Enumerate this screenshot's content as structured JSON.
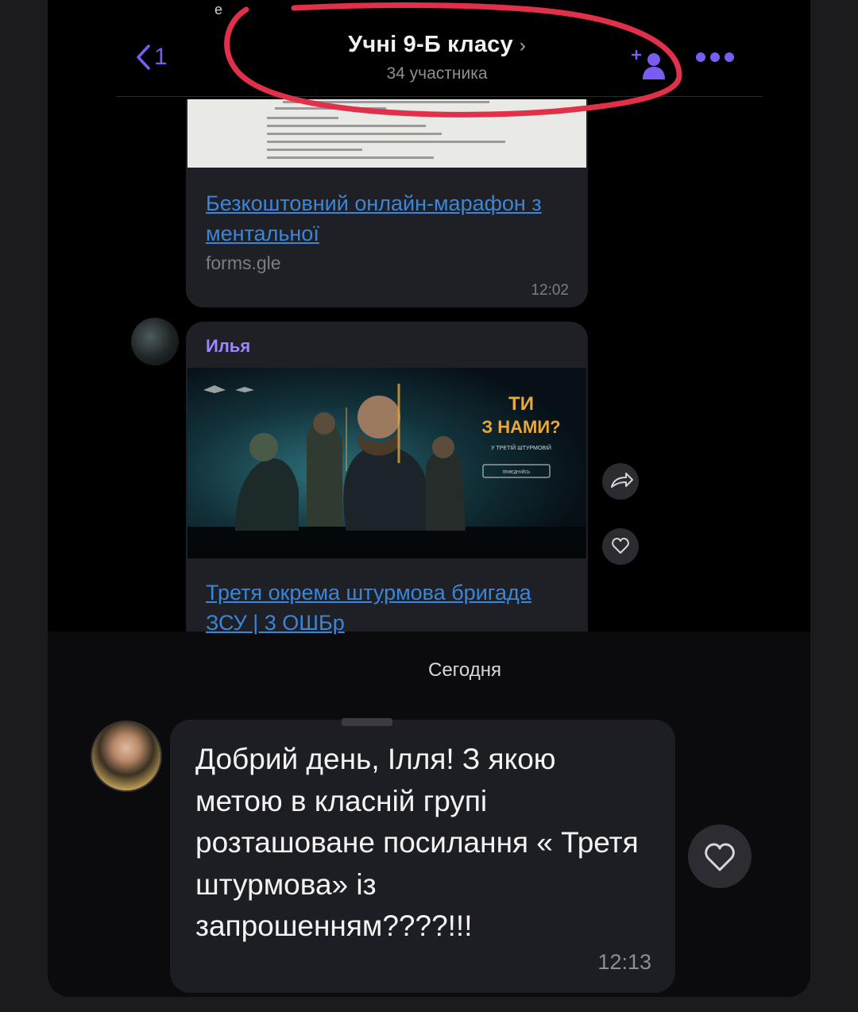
{
  "header": {
    "back_count": "1",
    "title": "Учні 9-Б класу",
    "subtitle": "34 участника",
    "cut_text": "e"
  },
  "colors": {
    "accent": "#7b5cf0",
    "link": "#3a86d8",
    "sender_name": "#9f86ff",
    "bubble": "#1f1f26",
    "annotation_circle": "#e0304a"
  },
  "icons": {
    "back": "chevron-left-icon",
    "title_chevron": "chevron-right-icon",
    "add_member": "add-person-icon",
    "more": "more-dots-icon",
    "share": "share-arrow-icon",
    "like": "heart-icon"
  },
  "messages": [
    {
      "link_title": "Безкоштовний онлайн-марафон з ментальної",
      "domain": "forms.gle",
      "time": "12:02"
    },
    {
      "sender": "Илья",
      "banner": {
        "headline_1": "ТИ",
        "headline_2": "З НАМИ?",
        "tagline": "У ТРЕТІЙ ШТУРМОВІЙ",
        "button": "ПРИЄДНУЙСЬ"
      },
      "link_title": "Третя окрема штурмова бригада ЗСУ | 3 ОШБр"
    }
  ],
  "date_separator": "Сегодня",
  "last_message": {
    "text": "Добрий день, Ілля! З якою метою в класній групі розташоване посилання « Третя штурмова» із запрошенням????!!!",
    "time": "12:13"
  }
}
